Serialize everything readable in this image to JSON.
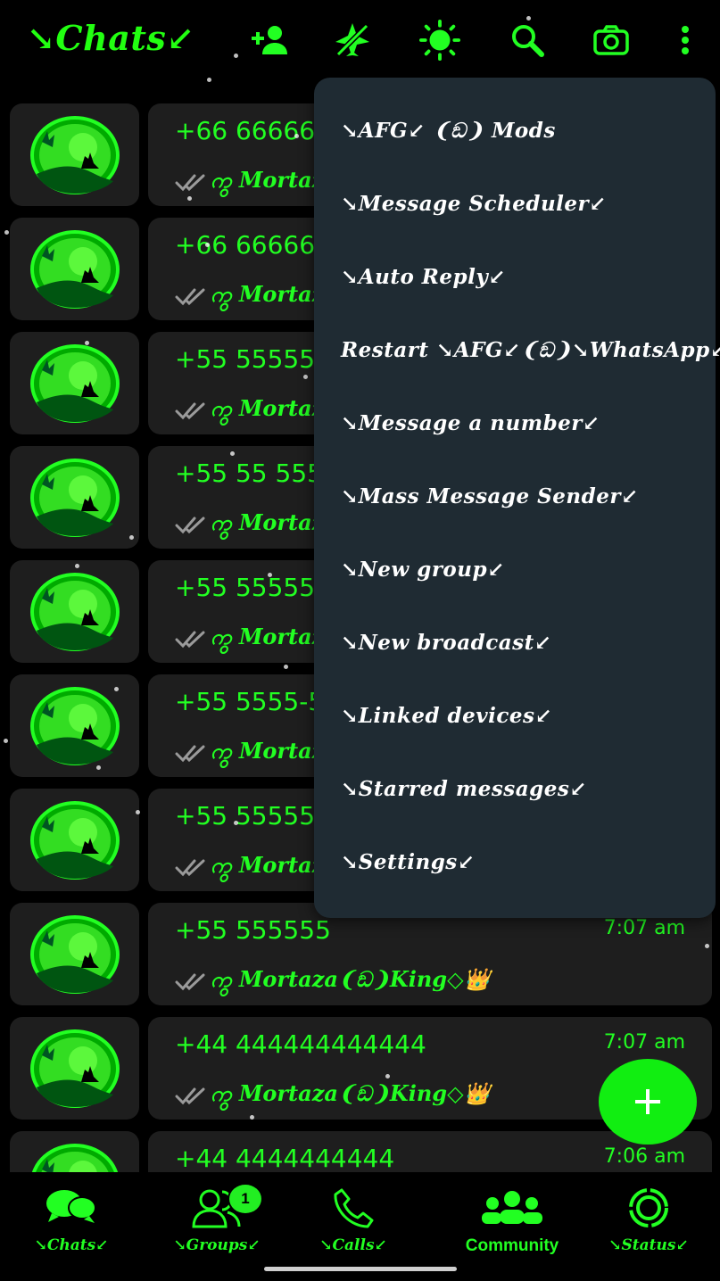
{
  "header": {
    "title": "↘Chats↙",
    "icons": [
      "add-contact-icon",
      "airplane-off-icon",
      "brightness-icon",
      "search-icon",
      "camera-icon",
      "more-vert-icon"
    ]
  },
  "colors": {
    "accent": "#22ff22",
    "menu_bg": "#1f2b33",
    "card_bg": "#1e1e1e",
    "background": "#000000"
  },
  "chats": [
    {
      "name": "+66 66666",
      "time": "",
      "message": "ကွ Mortaza"
    },
    {
      "name": "+66 66666",
      "time": "",
      "message": "ကွ Mortaza"
    },
    {
      "name": "+55 55555",
      "time": "",
      "message": "ကွ Mortaza"
    },
    {
      "name": "+55 55 555",
      "time": "",
      "message": "ကွ Mortaza"
    },
    {
      "name": "+55 55555",
      "time": "",
      "message": "ကွ Mortaza"
    },
    {
      "name": "+55 5555-5",
      "time": "",
      "message": "ကွ Mortaza"
    },
    {
      "name": "+55 55555",
      "time": "",
      "message": "ကွ Mortaza"
    },
    {
      "name": "+55 555555",
      "time": "7:07 am",
      "message": "ကွ Mortaza❨ඞ❩King◇👑"
    },
    {
      "name": "+44 444444444444",
      "time": "7:07 am",
      "message": "ကွ Mortaza❨ඞ❩King◇👑"
    },
    {
      "name": "+44 4444444444",
      "time": "7:06 am",
      "message": ""
    }
  ],
  "menu": {
    "items": [
      "↘AFG↙ ❨ඞ❩ Mods",
      "↘Message Scheduler↙",
      "↘Auto Reply↙",
      "Restart ↘AFG↙❨ඞ❩↘WhatsApp↙",
      "↘Message a number↙",
      "↘Mass Message Sender↙",
      "↘New group↙",
      "↘New broadcast↙",
      "↘Linked devices↙",
      "↘Starred messages↙",
      "↘Settings↙"
    ]
  },
  "fab": {
    "label": "+"
  },
  "nav": {
    "chats": "↘Chats↙",
    "groups": "↘Groups↙",
    "groups_badge": "1",
    "calls": "↘Calls↙",
    "community": "Community",
    "status": "↘Status↙"
  }
}
